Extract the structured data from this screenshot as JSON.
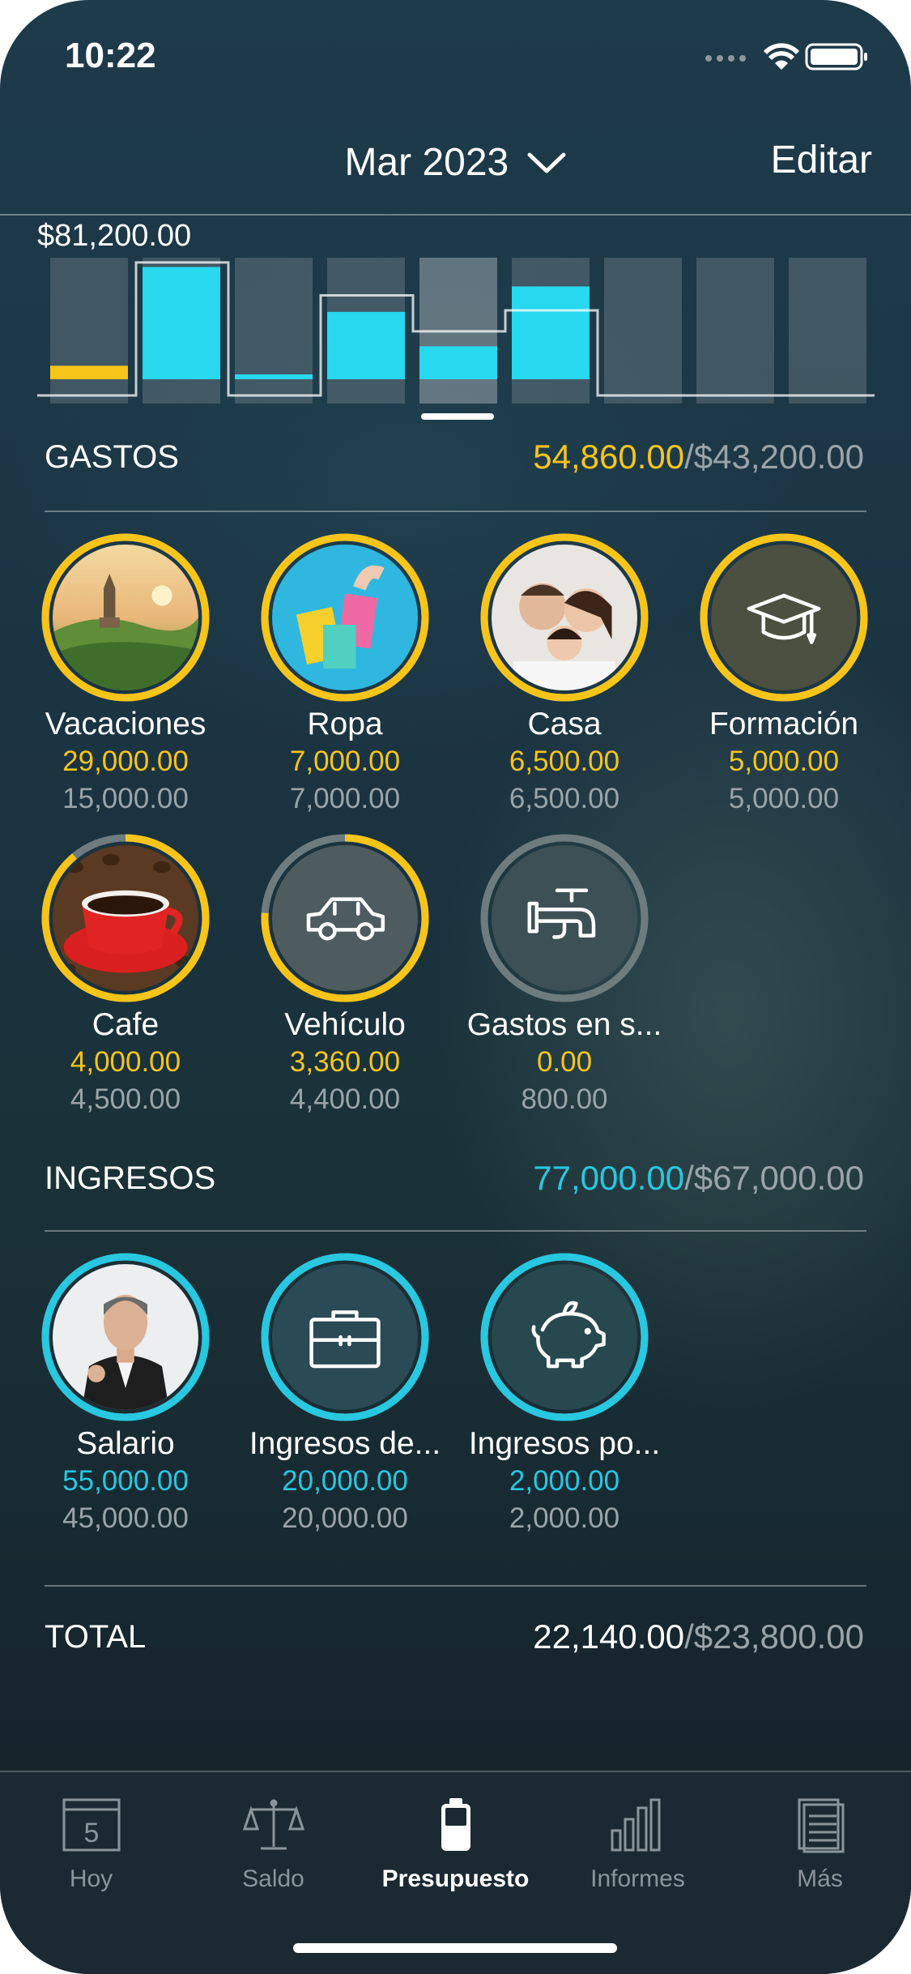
{
  "status_bar": {
    "time": "10:22"
  },
  "header": {
    "title": "Mar 2023",
    "edit_label": "Editar"
  },
  "chart_data": {
    "type": "bar",
    "title": "$81,200.00",
    "max_value": 81200,
    "bars": [
      {
        "value": 9000,
        "color": "#f7c51a",
        "active": false
      },
      {
        "value": 75000,
        "color": "#27d8ef",
        "active": false
      },
      {
        "value": 2000,
        "color": "#27d8ef",
        "active": false
      },
      {
        "value": 45000,
        "color": "#27d8ef",
        "active": false
      },
      {
        "value": 22000,
        "color": "#27d8ef",
        "active": true
      },
      {
        "value": 62000,
        "color": "#27d8ef",
        "active": false
      },
      {
        "value": 0,
        "color": "#27d8ef",
        "active": false
      },
      {
        "value": 0,
        "color": "#27d8ef",
        "active": false
      },
      {
        "value": 0,
        "color": "#27d8ef",
        "active": false
      }
    ],
    "line_values": [
      0,
      78000,
      0,
      56000,
      32000,
      46000,
      0,
      0,
      0
    ]
  },
  "gastos": {
    "title": "GASTOS",
    "actual": "54,860.00",
    "budget": "/$43,200.00",
    "items": [
      {
        "name": "Vacaciones",
        "actual": "29,000.00",
        "budget": "15,000.00",
        "progress": 1.0,
        "kind": "landscape"
      },
      {
        "name": "Ropa",
        "actual": "7,000.00",
        "budget": "7,000.00",
        "progress": 1.0,
        "kind": "bags"
      },
      {
        "name": "Casa",
        "actual": "6,500.00",
        "budget": "6,500.00",
        "progress": 1.0,
        "kind": "family"
      },
      {
        "name": "Formación",
        "actual": "5,000.00",
        "budget": "5,000.00",
        "progress": 1.0,
        "kind": "graduation"
      },
      {
        "name": "Cafe",
        "actual": "4,000.00",
        "budget": "4,500.00",
        "progress": 0.89,
        "kind": "coffee"
      },
      {
        "name": "Vehículo",
        "actual": "3,360.00",
        "budget": "4,400.00",
        "progress": 0.76,
        "kind": "car"
      },
      {
        "name": "Gastos en s...",
        "actual": "0.00",
        "budget": "800.00",
        "progress": 0.0,
        "kind": "faucet"
      }
    ]
  },
  "ingresos": {
    "title": "INGRESOS",
    "actual": "77,000.00",
    "budget": "/$67,000.00",
    "items": [
      {
        "name": "Salario",
        "actual": "55,000.00",
        "budget": "45,000.00",
        "progress": 1.0,
        "kind": "person"
      },
      {
        "name": "Ingresos de...",
        "actual": "20,000.00",
        "budget": "20,000.00",
        "progress": 1.0,
        "kind": "briefcase"
      },
      {
        "name": "Ingresos po...",
        "actual": "2,000.00",
        "budget": "2,000.00",
        "progress": 1.0,
        "kind": "piggy"
      }
    ]
  },
  "total": {
    "title": "TOTAL",
    "actual": "22,140.00",
    "budget": "/$23,800.00"
  },
  "tabbar": {
    "items": [
      {
        "label": "Hoy",
        "icon": "calendar-icon",
        "day": "5"
      },
      {
        "label": "Saldo",
        "icon": "scale-icon"
      },
      {
        "label": "Presupuesto",
        "icon": "battery-icon"
      },
      {
        "label": "Informes",
        "icon": "bar-chart-icon"
      },
      {
        "label": "Más",
        "icon": "document-icon"
      }
    ]
  },
  "colors": {
    "expense": "#f7c51a",
    "income": "#27c8e0",
    "muted": "#9aa4a8"
  }
}
